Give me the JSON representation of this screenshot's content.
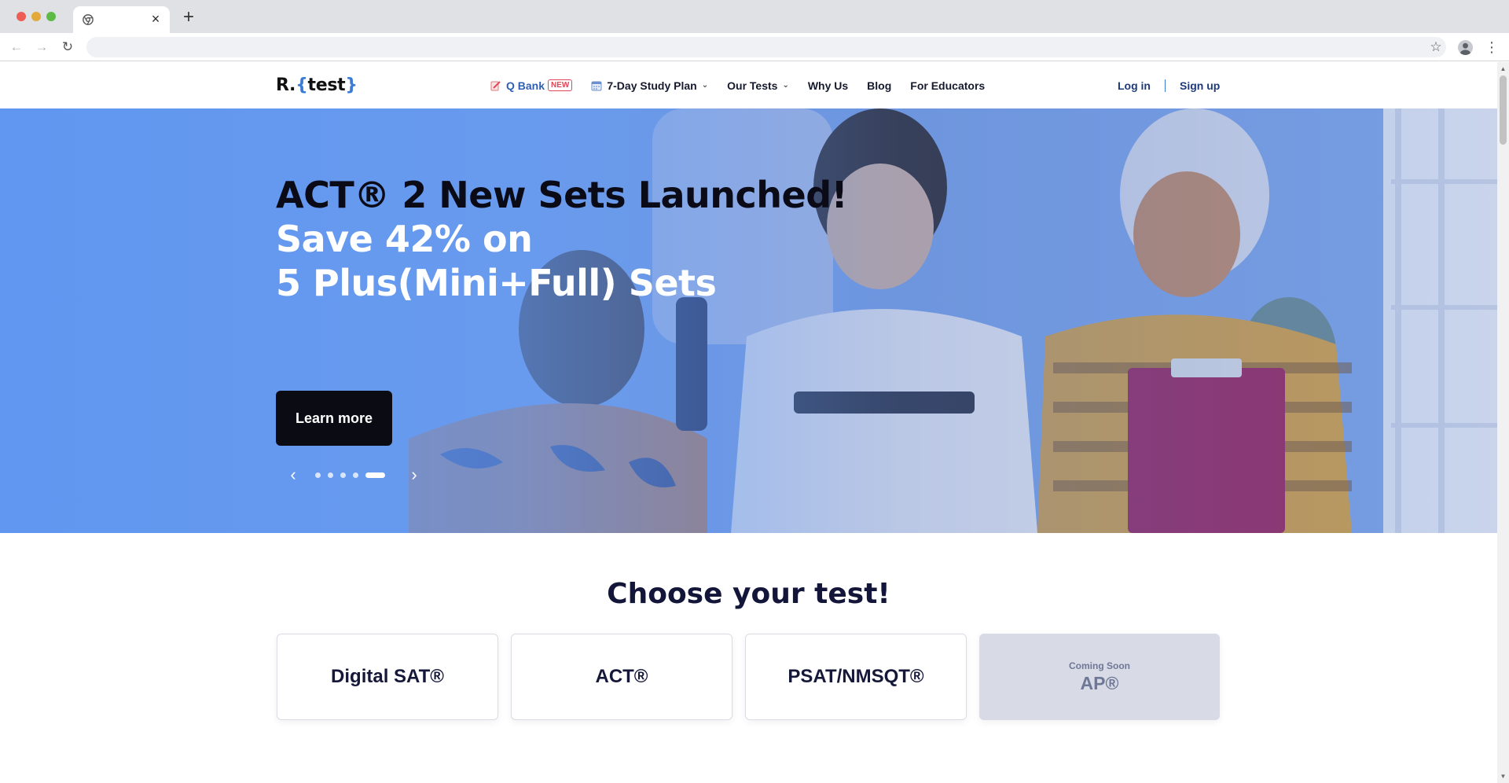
{
  "browser": {
    "url": "",
    "tab_close": "×",
    "new_tab": "+"
  },
  "header": {
    "logo_prefix": "R.",
    "logo_open": "{",
    "logo_word": "test",
    "logo_close": "}",
    "nav": {
      "qbank": "Q Bank",
      "qbank_badge": "NEW",
      "study_plan": "7-Day Study Plan",
      "our_tests": "Our Tests",
      "why_us": "Why Us",
      "blog": "Blog",
      "educators": "For Educators"
    },
    "login": "Log in",
    "signup": "Sign up"
  },
  "hero": {
    "title": "ACT® 2 New Sets Launched!",
    "line2": "Save 42% on",
    "line3": "5 Plus(Mini+Full) Sets",
    "cta": "Learn more",
    "slides_total": 5,
    "active_slide": 5
  },
  "choose": {
    "title": "Choose your test!",
    "cards": [
      {
        "label": "Digital SAT®"
      },
      {
        "label": "ACT®"
      },
      {
        "label": "PSAT/NMSQT®"
      }
    ],
    "coming_soon_label": "Coming Soon",
    "coming_soon_name": "AP®"
  },
  "colors": {
    "hero_blue": "#6f9fea",
    "brand_navy": "#131638",
    "accent_blue": "#3a7bd5",
    "badge_red": "#e0485a"
  }
}
